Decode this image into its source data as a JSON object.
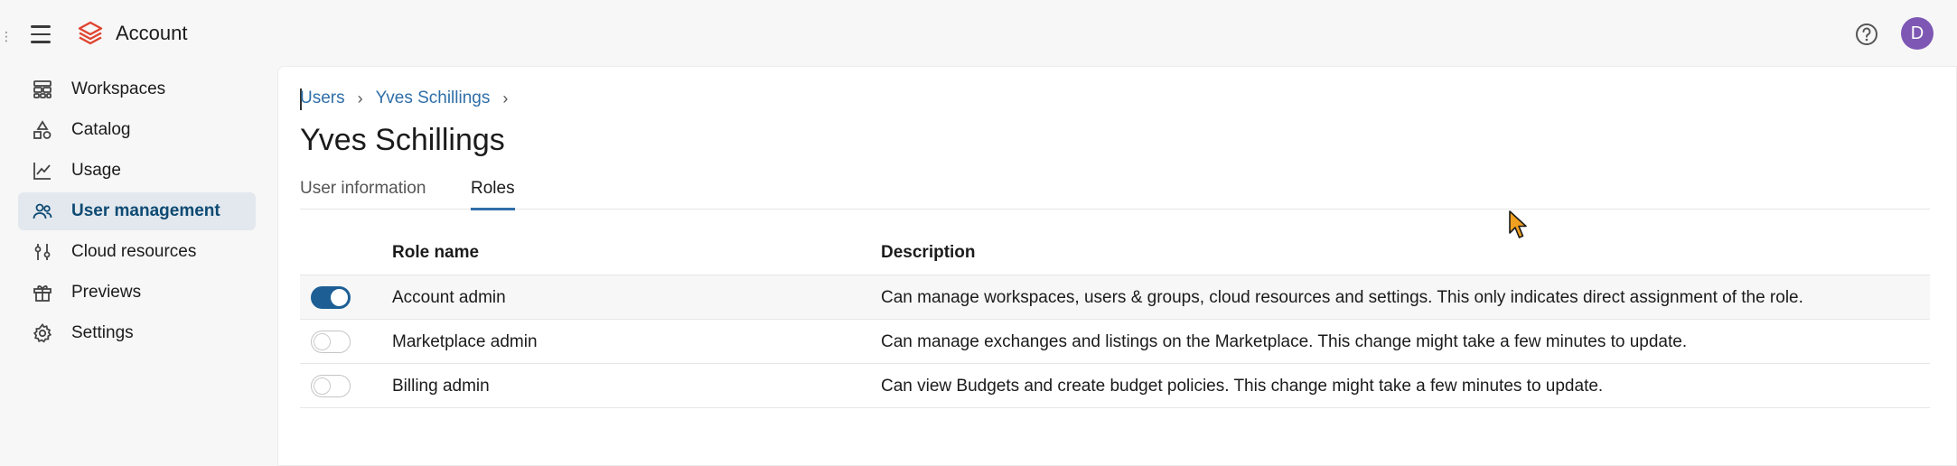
{
  "app": {
    "title": "Account",
    "avatar_initial": "D"
  },
  "icons": {
    "menu": "hamburger-menu-icon",
    "logo": "databricks-logo",
    "help": "help-icon"
  },
  "sidebar": {
    "items": [
      {
        "label": "Workspaces",
        "icon": "workspaces-icon"
      },
      {
        "label": "Catalog",
        "icon": "catalog-icon"
      },
      {
        "label": "Usage",
        "icon": "usage-icon"
      },
      {
        "label": "User management",
        "icon": "users-icon",
        "active": true
      },
      {
        "label": "Cloud resources",
        "icon": "cloud-resources-icon"
      },
      {
        "label": "Previews",
        "icon": "gift-icon"
      },
      {
        "label": "Settings",
        "icon": "gear-icon"
      }
    ]
  },
  "breadcrumb": {
    "items": [
      "Users",
      "Yves Schillings"
    ],
    "separator": "›"
  },
  "page": {
    "title": "Yves Schillings"
  },
  "tabs": [
    {
      "label": "User information",
      "active": false
    },
    {
      "label": "Roles",
      "active": true
    }
  ],
  "table": {
    "headers": {
      "name": "Role name",
      "description": "Description"
    },
    "rows": [
      {
        "enabled": true,
        "name": "Account admin",
        "description": "Can manage workspaces, users & groups, cloud resources and settings. This only indicates direct assignment of the role."
      },
      {
        "enabled": false,
        "name": "Marketplace admin",
        "description": "Can manage exchanges and listings on the Marketplace. This change might take a few minutes to update."
      },
      {
        "enabled": false,
        "name": "Billing admin",
        "description": "Can view Budgets and create budget policies. This change might take a few minutes to update."
      }
    ]
  },
  "colors": {
    "accent": "#2f6fa8",
    "toggle_on": "#1d5f95",
    "avatar": "#7d57b3",
    "logo": "#e0432f"
  }
}
